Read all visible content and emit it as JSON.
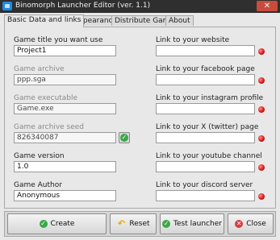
{
  "window": {
    "title": "Binomorph Launcher Editor (ver. 1.1)",
    "close_glyph": "✕"
  },
  "tabs": [
    {
      "label": "Basic Data and links"
    },
    {
      "label": "Appearance"
    },
    {
      "label": "Distribute Game"
    },
    {
      "label": "About"
    }
  ],
  "left": {
    "game_title": {
      "label": "Game title you want use",
      "value": "Project1"
    },
    "game_archive": {
      "label": "Game archive",
      "value": "ppp.sga"
    },
    "game_executable": {
      "label": "Game executable",
      "value": "Game.exe"
    },
    "archive_seed": {
      "label": "Game archive seed",
      "value": "826340087"
    },
    "game_version": {
      "label": "Game version",
      "value": "1.0"
    },
    "game_author": {
      "label": "Game Author",
      "value": "Anonymous"
    }
  },
  "right": {
    "website": {
      "label": "Link to your website",
      "value": ""
    },
    "facebook": {
      "label": "Link to your facebook page",
      "value": ""
    },
    "instagram": {
      "label": "Link to your instagram profile",
      "value": ""
    },
    "twitter": {
      "label": "Link to your X (twitter) page",
      "value": ""
    },
    "youtube": {
      "label": "Link to your youtube channel",
      "value": ""
    },
    "discord": {
      "label": "Link to your discord server",
      "value": ""
    }
  },
  "status_color": "#d21414",
  "buttons": {
    "create": "Create",
    "reset": "Reset",
    "test": "Test launcher",
    "close": "Close"
  },
  "icons": {
    "create": "green-check-icon",
    "reset": "undo-icon",
    "test": "green-check-icon",
    "close": "red-x-icon"
  }
}
